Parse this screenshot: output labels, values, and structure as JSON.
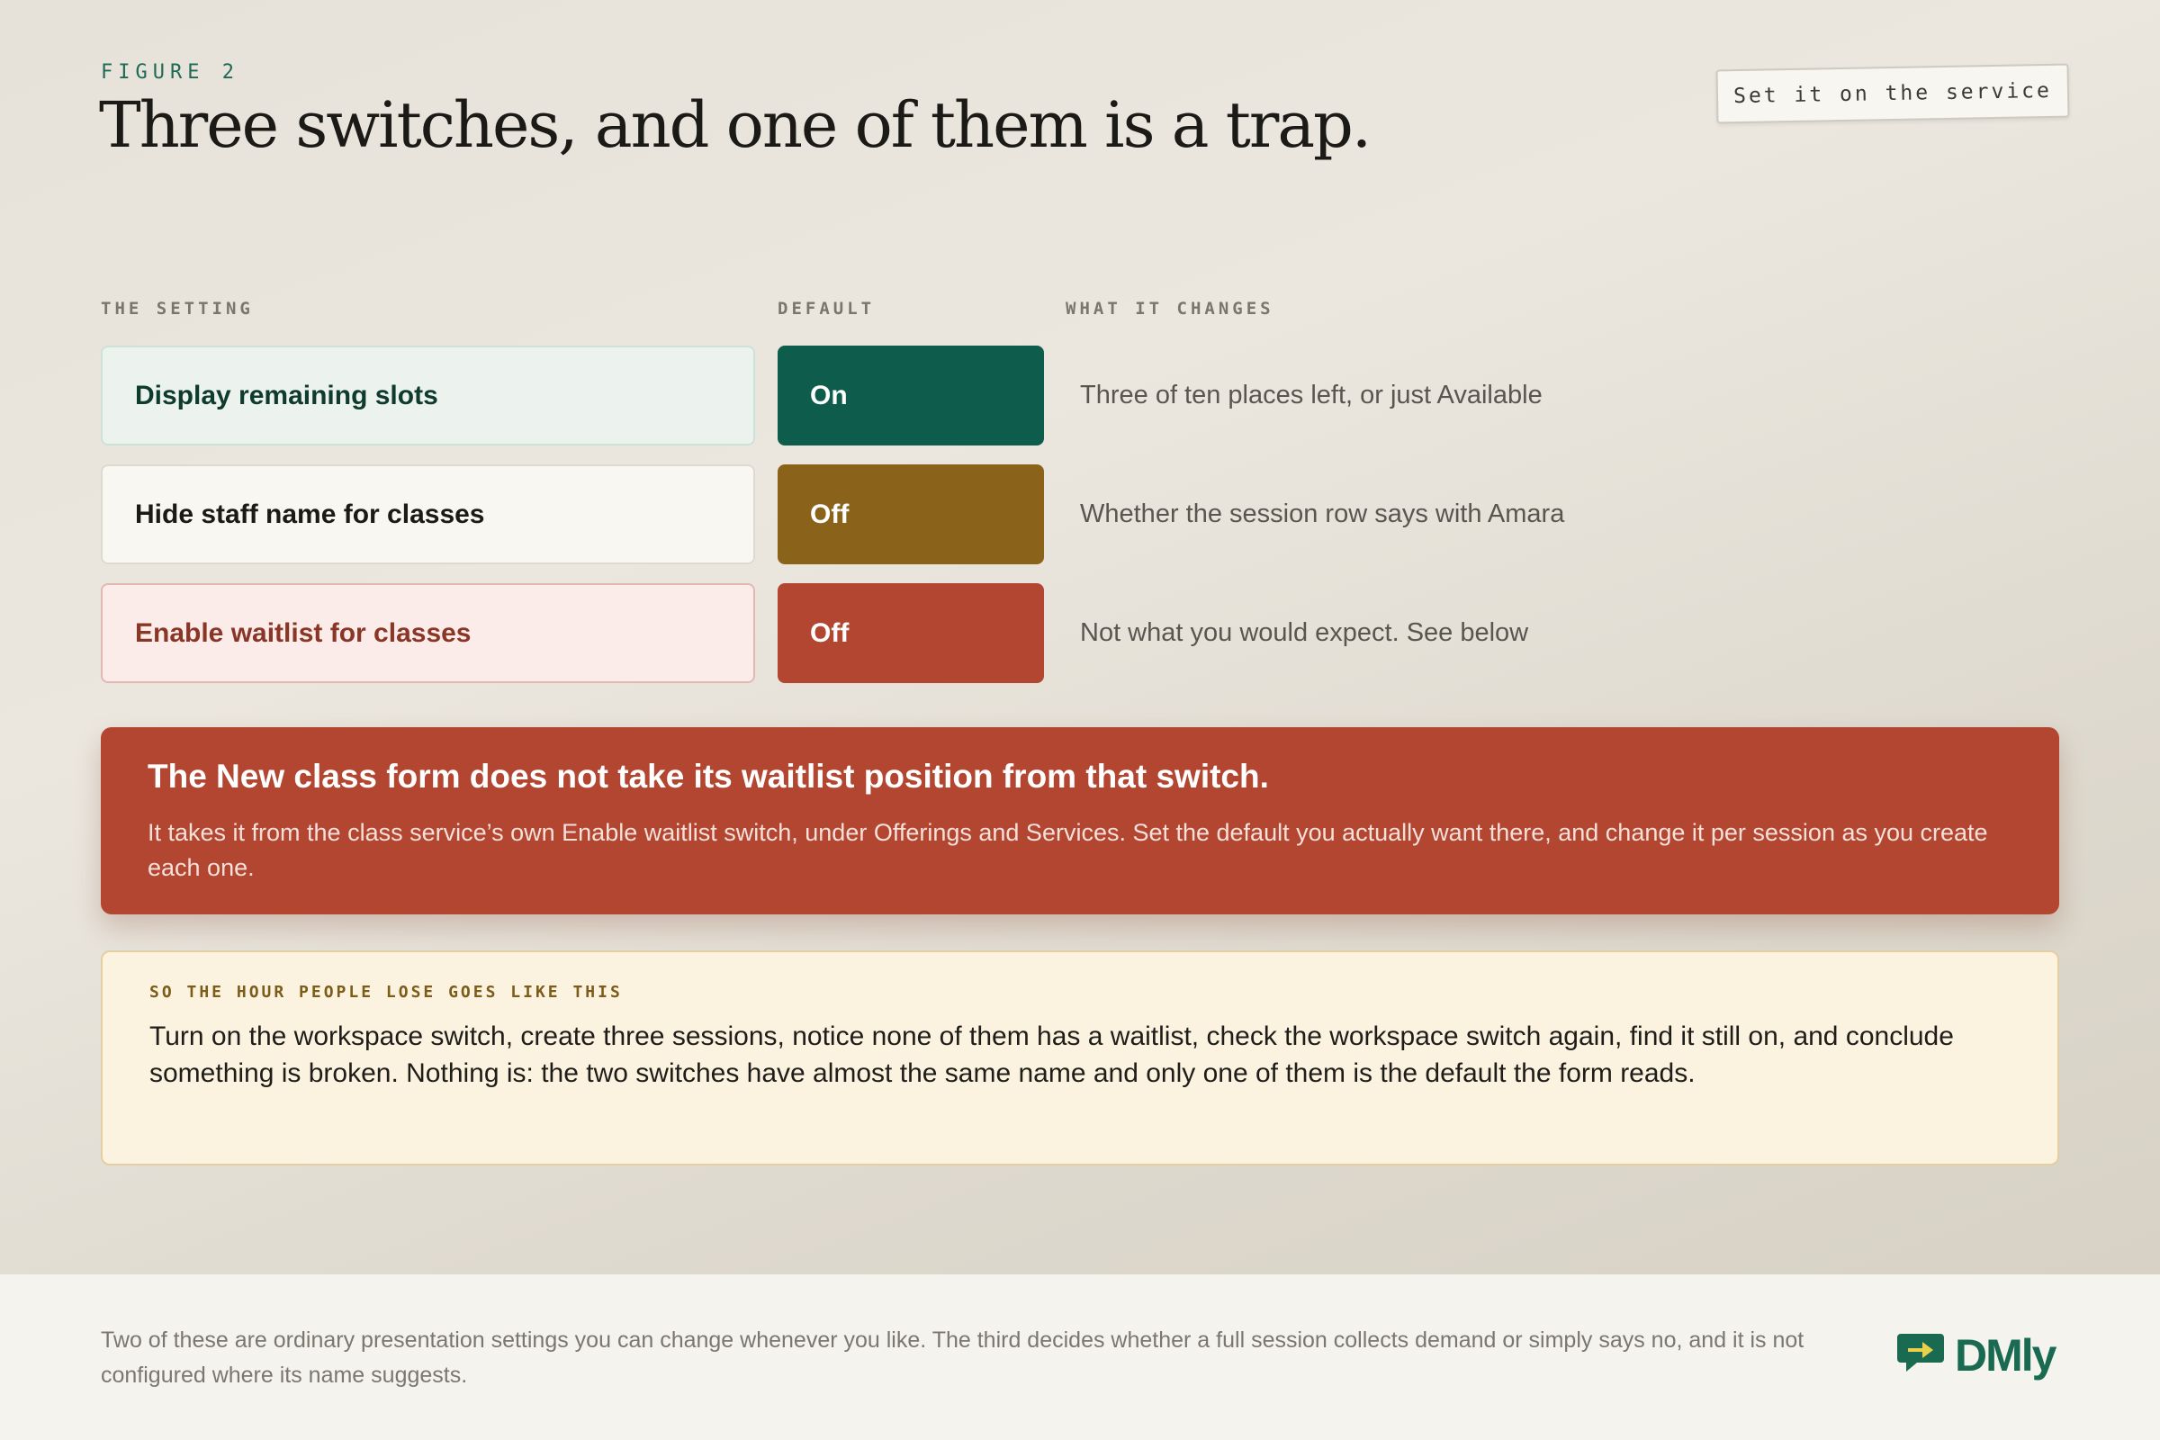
{
  "header": {
    "eyebrow": "FIGURE 2",
    "title": "Three switches, and one of them is a trap.",
    "tag": "Set it on the service"
  },
  "columns": {
    "setting": "THE SETTING",
    "default": "DEFAULT",
    "changes": "WHAT IT CHANGES"
  },
  "rows": [
    {
      "setting": "Display remaining slots",
      "default": "On",
      "changes": "Three of ten places left, or just Available",
      "color": "#0e5c4b"
    },
    {
      "setting": "Hide staff name for classes",
      "default": "Off",
      "changes": "Whether the session row says with Amara",
      "color": "#8a621a"
    },
    {
      "setting": "Enable waitlist for classes",
      "default": "Off",
      "changes": "Not what you would expect. See below",
      "color": "#b24631"
    }
  ],
  "alert": {
    "title": "The New class form does not take its waitlist position from that switch.",
    "body": "It takes it from the class service’s own Enable waitlist switch, under Offerings and Services. Set the default you actually want there, and change it per session as you create each one."
  },
  "note": {
    "heading": "SO THE HOUR PEOPLE LOSE GOES LIKE THIS",
    "body": "Turn on the workspace switch, create three sessions, notice none of them has a waitlist, check the workspace switch again, find it still on, and conclude something is broken. Nothing is: the two switches have almost the same name and only one of them is the default the form reads."
  },
  "footer": {
    "text": "Two of these are ordinary presentation settings you can change whenever you like. The third decides whether a full session collects demand or simply says no, and it is not configured where its name suggests.",
    "brand": "DMly",
    "brand_icon": "chat-arrow-logo-icon"
  }
}
